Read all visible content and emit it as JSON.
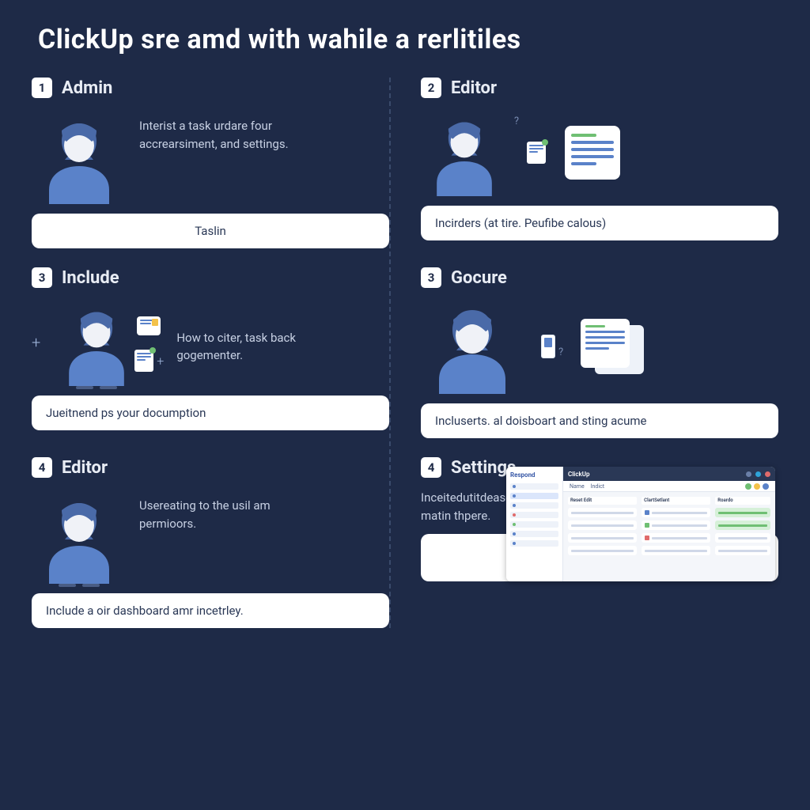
{
  "title": "ClickUp sre amd with wahile a rerlitiles",
  "cells": [
    {
      "num": "1",
      "title": "Admin",
      "desc": "Interist a task urdare four accrearsiment, and settings.",
      "pill": "Taslin"
    },
    {
      "num": "2",
      "title": "Editor",
      "desc": "",
      "pill": "Incirders (at tire. Peufibe calous)"
    },
    {
      "num": "3",
      "title": "Include",
      "desc": "How to citer, task back gogementer.",
      "pill": "Jueitnend ps your documption"
    },
    {
      "num": "3",
      "title": "Gocure",
      "desc": "",
      "pill": "Incluserts. al doisboart and sting acume"
    },
    {
      "num": "4",
      "title": "Editor",
      "desc": "Usereating to the usil am permioors.",
      "pill": "Include a oir dashboard amr incetrley."
    },
    {
      "num": "4",
      "title": "Settings",
      "desc": "Inceitedutitdeascooor servving with jour our mess and matin thpere.",
      "pill": ""
    }
  ],
  "miniApp": {
    "brand": "ClickUp",
    "sidebarLogo": "Respond",
    "tab1": "Name",
    "tab2": "Indict",
    "col1": "Reset Edit",
    "col2": "ClartSetlant",
    "col3": "Roardo"
  }
}
